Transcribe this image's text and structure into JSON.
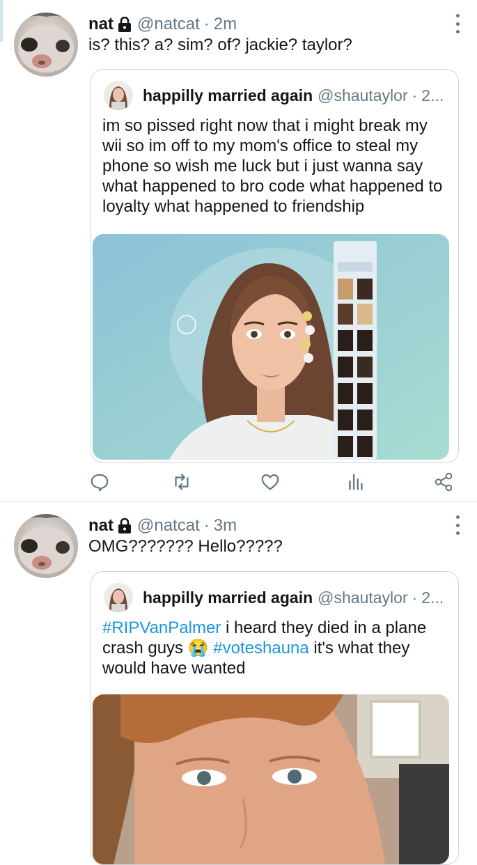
{
  "tweets": [
    {
      "author_name": "nat",
      "handle": "@natcat",
      "separator": "·",
      "time": "2m",
      "text": "is? this? a? sim? of? jackie? taylor?",
      "quote": {
        "author_name": "happilly married again",
        "handle": "@shautaylor",
        "separator": "·",
        "time": "2...",
        "text": "im so pissed right now that i might break my wii so im off to my mom's office to steal my phone so wish me luck but i just wanna say what happened to bro code what happened to loyalty what happened to friendship"
      },
      "actions": [
        "reply-icon",
        "retweet-icon",
        "like-icon",
        "analytics-icon",
        "share-icon"
      ]
    },
    {
      "author_name": "nat",
      "handle": "@natcat",
      "separator": "·",
      "time": "3m",
      "text": "OMG??????? Hello?????",
      "quote": {
        "author_name": "happilly married again",
        "handle": "@shautaylor",
        "separator": "·",
        "time": "2...",
        "hashtag_1": "#RIPVanPalmer",
        "text_1": " i heard they died in a plane crash guys ",
        "emoji": "😭",
        "hashtag_2": "#voteshauna",
        "text_2": " it's what they would have wanted"
      }
    }
  ],
  "colors": {
    "text": "#14171a",
    "secondary": "#657786",
    "link": "#1b95e0",
    "border": "#ccd6dd"
  }
}
